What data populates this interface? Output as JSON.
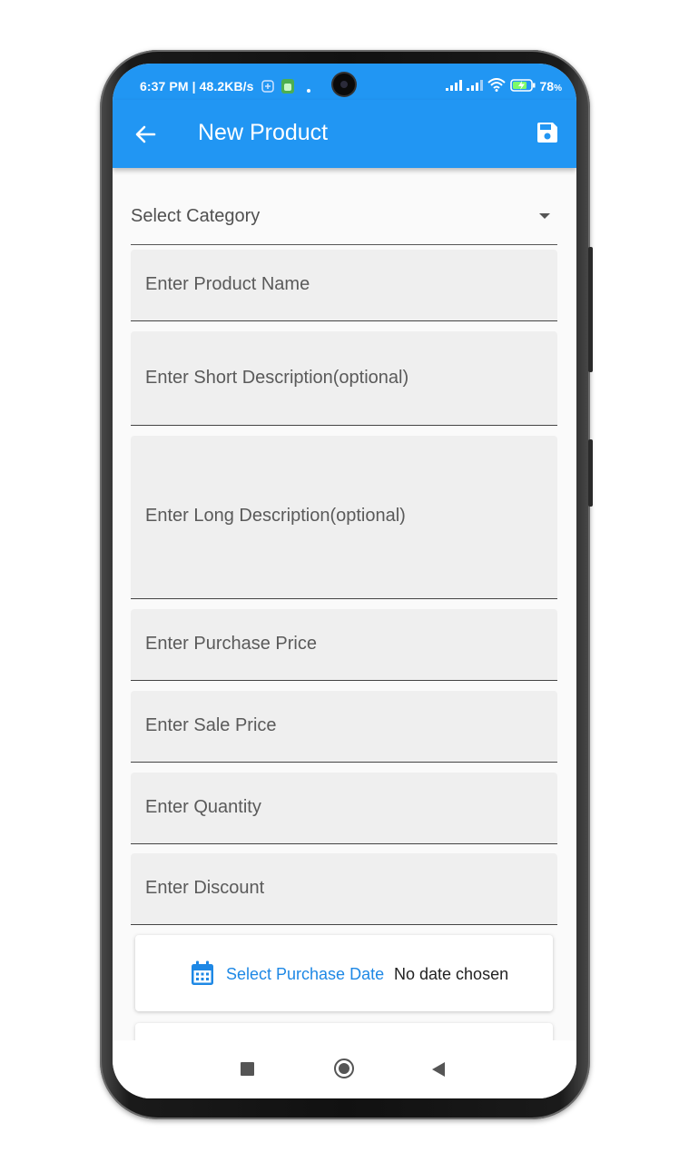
{
  "status_bar": {
    "time_speed": "6:37 PM | 48.2KB/s",
    "battery_level": "78",
    "battery_unit": "%"
  },
  "app_bar": {
    "title": "New Product",
    "back_icon": "arrow-left-icon",
    "save_icon": "floppy-save-icon"
  },
  "form": {
    "category_label": "Select Category",
    "product_name_placeholder": "Enter Product Name",
    "short_desc_placeholder": "Enter Short Description(optional)",
    "long_desc_placeholder": "Enter Long Description(optional)",
    "purchase_price_placeholder": "Enter Purchase Price",
    "sale_price_placeholder": "Enter Sale Price",
    "quantity_placeholder": "Enter Quantity",
    "discount_placeholder": "Enter Discount",
    "purchase_date_button": "Select Purchase Date",
    "purchase_date_value": "No date chosen"
  },
  "colors": {
    "primary": "#2196f3",
    "accent_text": "#1e88e5",
    "field_bg": "#efefef"
  }
}
